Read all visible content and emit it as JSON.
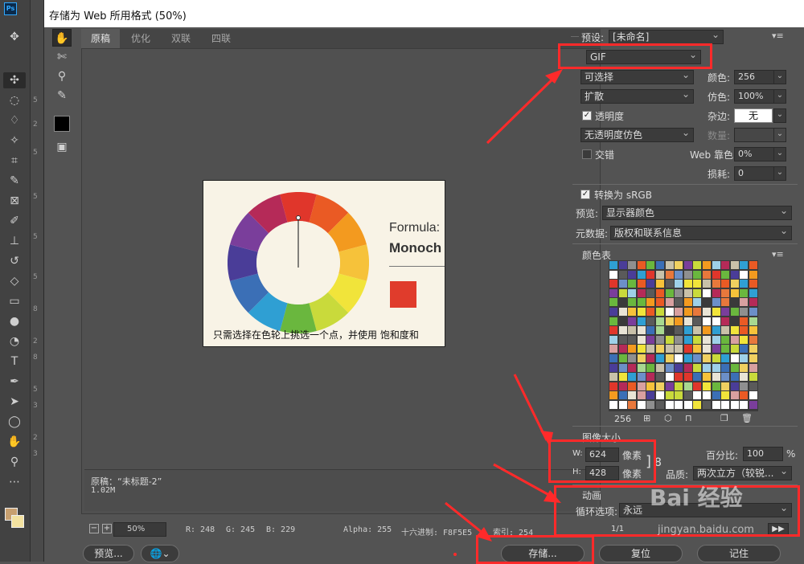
{
  "window": {
    "title": "存储为 Web 所用格式 (50%)"
  },
  "toolbar_ps": {
    "logo": "Ps",
    "tools": [
      "move-icon",
      "marquee-icon",
      "lasso-icon",
      "magic-wand-icon",
      "crop-icon",
      "eyedropper-icon",
      "frame-icon",
      "brush-icon",
      "stamp-icon",
      "history-brush-icon",
      "eraser-icon",
      "gradient-icon",
      "blur-icon",
      "dodge-icon",
      "pen-icon",
      "type-icon",
      "path-select-icon",
      "shape-icon",
      "hand-icon",
      "zoom-icon",
      "more-icon"
    ],
    "ruler_numbers": [
      "5",
      "2",
      "5",
      "5",
      "5",
      "5",
      "8",
      "2",
      "8",
      "5",
      "3",
      "2",
      "3"
    ]
  },
  "tabs": [
    {
      "label": "原稿",
      "active": true
    },
    {
      "label": "优化"
    },
    {
      "label": "双联"
    },
    {
      "label": "四联"
    }
  ],
  "preview": {
    "formula": "Formula:",
    "monoch": "Monoch",
    "caption": "只需选择在色轮上挑选一个点，并使用 饱和度和"
  },
  "info": {
    "line1": "原稿：“未标题-2”",
    "line2": "1.02M"
  },
  "status": {
    "zoom": "50%",
    "r": "R: 248",
    "g": "G: 245",
    "b": "B: 229",
    "alpha": "Alpha: 255",
    "hex": "十六进制: F8F5E5",
    "index": "索引: 254"
  },
  "buttons": {
    "preview": "预览...",
    "save": "存储...",
    "reset": "复位",
    "remember": "记住"
  },
  "panel": {
    "preset_label": "预设:",
    "preset_value": "[未命名]",
    "format": "GIF",
    "reduction": "可选择",
    "colors_label": "颜色:",
    "colors_value": "256",
    "dither_algo": "扩散",
    "dither_label": "仿色:",
    "dither_value": "100%",
    "transparency_label": "透明度",
    "matte_label": "杂边:",
    "matte_value": "无",
    "trans_dither": "无透明度仿色",
    "amount_label": "数量:",
    "interlaced_label": "交错",
    "websnap_label": "Web 靠色:",
    "websnap_value": "0%",
    "lossy_label": "损耗:",
    "lossy_value": "0",
    "convert_label": "转换为 sRGB",
    "preview_label": "预览:",
    "preview_value": "显示器颜色",
    "metadata_label": "元数据:",
    "metadata_value": "版权和联系信息",
    "color_table_title": "颜色表",
    "color_count": "256",
    "image_size_title": "图像大小",
    "w_label": "W:",
    "w_value": "624",
    "w_unit": "像素",
    "h_label": "H:",
    "h_value": "428",
    "h_unit": "像素",
    "percent_label": "百分比:",
    "percent_value": "100",
    "percent_unit": "%",
    "quality_label": "品质:",
    "quality_value": "两次立方（较锐...",
    "animation_title": "动画",
    "loop_label": "循环选项:",
    "loop_value": "永远",
    "frame_counter": "1/1"
  },
  "watermark": {
    "brand": "Bai 经验",
    "url": "jingyan.baidu.com"
  }
}
